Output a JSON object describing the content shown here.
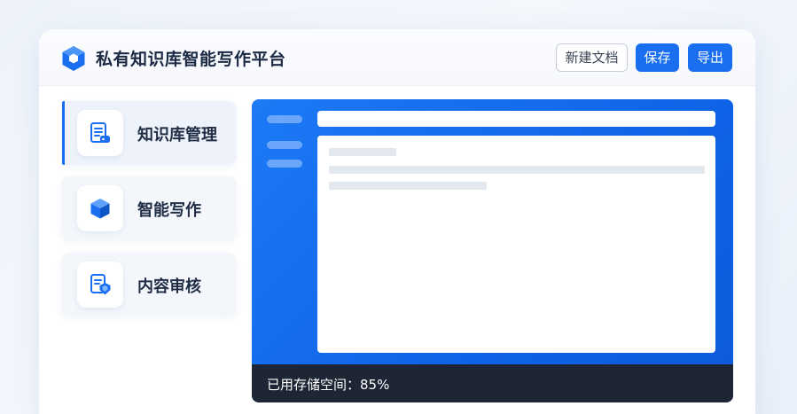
{
  "app": {
    "title": "私有知识库智能写作平台",
    "logo_icon": "hexagon-logo-icon",
    "accent_color": "#1a6ff0"
  },
  "toolbar": {
    "new_doc_label": "新建文档",
    "save_label": "保存",
    "export_label": "导出"
  },
  "sidebar": {
    "items": [
      {
        "label": "知识库管理",
        "icon": "document-tag-icon",
        "active": true
      },
      {
        "label": "智能写作",
        "icon": "cube-icon",
        "active": false
      },
      {
        "label": "内容审核",
        "icon": "document-shield-icon",
        "active": false
      }
    ]
  },
  "editor": {
    "background_color": "#1a6ff0",
    "status_text": "已用存储空间：85%",
    "storage_used_percent": 85
  }
}
